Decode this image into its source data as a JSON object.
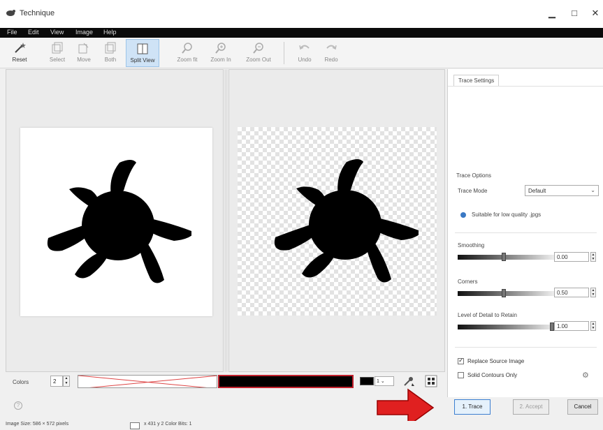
{
  "window": {
    "title": "Technique",
    "minimize_glyph": "□",
    "maximize_glyph": "□",
    "close_glyph": "✕"
  },
  "menu": [
    "File",
    "Edit",
    "View",
    "Image",
    "Help"
  ],
  "toolbar": {
    "items": [
      {
        "label": "Reset",
        "icon": "wand-icon"
      },
      {
        "label": "Select",
        "icon": "select-icon"
      },
      {
        "label": "Move",
        "icon": "move-icon"
      },
      {
        "label": "Both",
        "icon": "both-icon"
      },
      {
        "label": "Split View",
        "icon": "split-view-icon"
      },
      {
        "label": "Zoom fit",
        "icon": "zoom-fit-icon"
      },
      {
        "label": "Zoom In",
        "icon": "zoom-in-icon"
      },
      {
        "label": "Zoom Out",
        "icon": "zoom-out-icon"
      },
      {
        "label": "Undo",
        "icon": "undo-icon"
      },
      {
        "label": "Redo",
        "icon": "redo-icon"
      }
    ]
  },
  "panel": {
    "tab": "Trace Settings",
    "trace_options_title": "Trace Options",
    "trace_mode_label": "Trace Mode",
    "trace_mode_value": "Default",
    "hint": "Suitable for low quality .jpgs",
    "smoothing_label": "Smoothing",
    "smoothing_value": "0.00",
    "smoothing_level": 0.48,
    "corners_label": "Corners",
    "corners_value": "0.50",
    "corners_level": 0.48,
    "detail_label": "Level of Detail to Retain",
    "detail_value": "1.00",
    "detail_level": 1.0,
    "replace_source_label": "Replace Source Image",
    "replace_source_checked": true,
    "solid_contours_label": "Solid Contours Only",
    "solid_contours_checked": false
  },
  "colors": {
    "label": "Colors",
    "count": "2",
    "fg_value": "1"
  },
  "buttons": {
    "trace": "1. Trace",
    "accept": "2. Accept",
    "cancel": "Cancel"
  },
  "status": {
    "image_size": "Image Size: 586 × 572 pixels",
    "color_info": "x 431 y 2  Color Bits: 1"
  },
  "accent_colors": {
    "selection_blue": "#cfe3f6",
    "swatch_border_red": "#c0202c",
    "arrow_red": "#e02020"
  }
}
